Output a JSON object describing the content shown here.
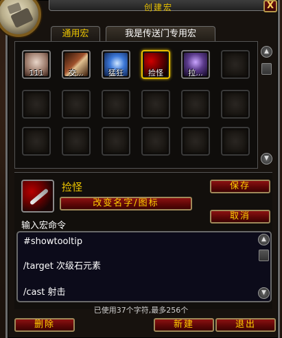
{
  "window": {
    "title": "创建宏",
    "close_label": "X"
  },
  "tabs": [
    {
      "label": "通用宏",
      "active": false
    },
    {
      "label": "我是传送门专用宏",
      "active": true
    }
  ],
  "macros": [
    {
      "label": "111",
      "icon": "rabbit-icon",
      "color": "#b9a79a"
    },
    {
      "label": "交...",
      "icon": "blade-icon",
      "color": "#7a3a1a"
    },
    {
      "label": "猛狂",
      "icon": "blue-spell-icon",
      "color": "#2f5fb8"
    },
    {
      "label": "捡怪",
      "icon": "bloody-dagger-icon",
      "color": "#9a0000",
      "selected": true
    },
    {
      "label": "拉...",
      "icon": "shadow-face-icon",
      "color": "#5a3a8a"
    }
  ],
  "selected_macro": {
    "name": "捡怪",
    "icon": "bloody-dagger-icon"
  },
  "buttons": {
    "save": "保存",
    "change_name_icon": "改变名字/图标",
    "cancel": "取消",
    "delete": "删除",
    "new": "新建",
    "exit": "退出"
  },
  "editor": {
    "prompt": "输入宏命令",
    "lines": [
      "#showtooltip",
      "/target 次级石元素",
      "/cast 射击"
    ]
  },
  "counter": "已使用37个字符,最多256个"
}
